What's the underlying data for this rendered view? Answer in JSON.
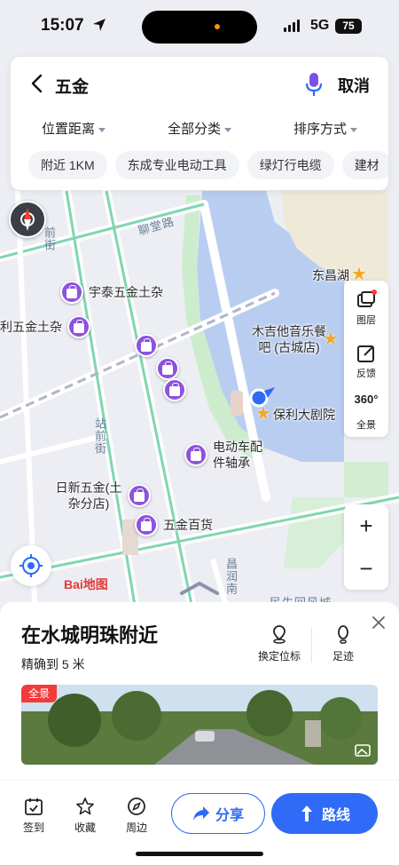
{
  "status_bar": {
    "time": "15:07",
    "network": "5G",
    "battery": "75"
  },
  "search": {
    "query": "五金",
    "cancel_label": "取消"
  },
  "filters": [
    "位置距离",
    "全部分类",
    "排序方式"
  ],
  "chips": [
    "附近 1KM",
    "东成专业电动工具",
    "绿灯行电缆",
    "建材"
  ],
  "map": {
    "road_labels": [
      "聊堂路",
      "站前街",
      "前街",
      "昌润南",
      "民生回风城",
      "东昌路"
    ],
    "pois": [
      "宇泰五金土杂",
      "利五金土杂",
      "电动车配件轴承",
      "日新五金(土杂分店)",
      "五金百货"
    ],
    "places": [
      "东昌湖",
      "木吉他音乐餐吧 (古城店)",
      "保利大剧院"
    ],
    "logo": "Bai地图"
  },
  "tools": {
    "layers": "图层",
    "feedback": "反馈",
    "panorama": "全景",
    "panorama_badge": "360°"
  },
  "card": {
    "title": "在水城明珠附近",
    "accuracy": "精确到 5 米",
    "fix_location": "换定位标",
    "footprint": "足迹",
    "pano_badge": "全景"
  },
  "bottom_bar": {
    "checkin": "签到",
    "favorite": "收藏",
    "nearby": "周边",
    "share": "分享",
    "route": "路线"
  }
}
